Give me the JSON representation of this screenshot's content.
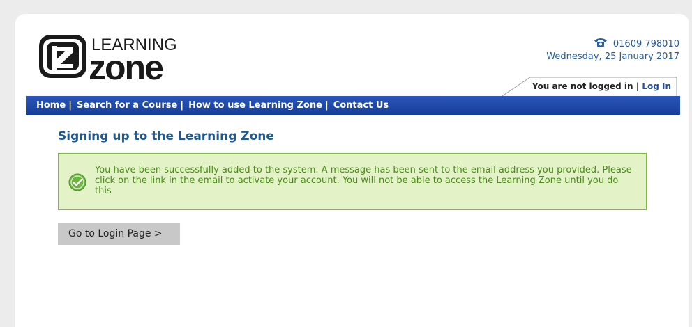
{
  "header": {
    "logo_text_top": "LEARNING",
    "logo_text_bottom": "zone",
    "phone": "01609 798010",
    "date": "Wednesday, 25 January 2017",
    "login_status": "You are not logged in |",
    "login_link": "Log In"
  },
  "nav": {
    "items": [
      {
        "label": "Home"
      },
      {
        "label": "Search for a Course"
      },
      {
        "label": "How to use Learning Zone"
      },
      {
        "label": "Contact Us"
      }
    ],
    "separator": "|"
  },
  "main": {
    "title": "Signing up to the Learning Zone",
    "alert_message": "You have been successfully added to the system. A message has been sent to the email address you provided. Please click on the link in the email to activate your account. You will not be able to access the Learning Zone until you do this",
    "login_button": "Go to Login Page >"
  },
  "colors": {
    "nav_blue": "#1f4aa8",
    "title_blue": "#1d5a94",
    "alert_bg": "#e3f2c7",
    "alert_border": "#7cbb3a",
    "alert_text": "#4b8a18",
    "button_bg": "#c8c8c8"
  },
  "icons": {
    "phone": "telephone-icon",
    "success": "check-circle-icon"
  }
}
